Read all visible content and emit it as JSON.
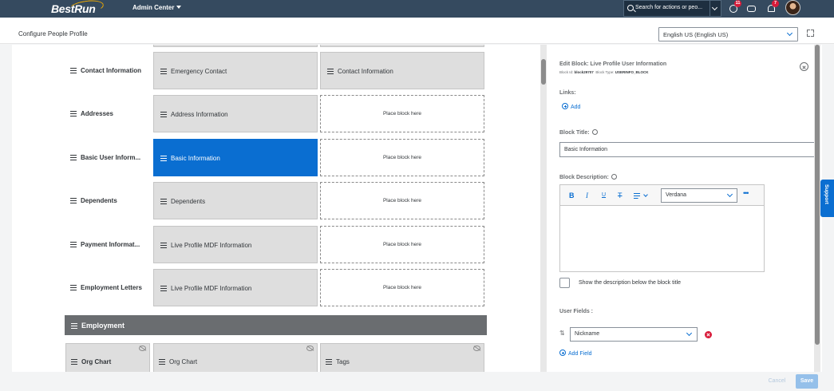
{
  "shell": {
    "logo": "BestRun",
    "menu_label": "Admin Center",
    "search_placeholder": "Search for actions or peo...",
    "notification_count": "11",
    "alert_count": "7"
  },
  "header": {
    "page_title": "Configure People Profile",
    "language": "English US (English US)"
  },
  "sections": [
    {
      "label": "Contact Information",
      "block1": "Emergency Contact",
      "block2": "Contact Information"
    },
    {
      "label": "Addresses",
      "block1": "Address Information",
      "block2": "Place block here"
    },
    {
      "label": "Basic User Inform...",
      "block1": "Basic Information",
      "block2": "Place block here"
    },
    {
      "label": "Dependents",
      "block1": "Dependents",
      "block2": "Place block here"
    },
    {
      "label": "Payment Informat...",
      "block1": "Live Profile MDF Information",
      "block2": "Place block here"
    },
    {
      "label": "Employment Letters",
      "block1": "Live Profile MDF Information",
      "block2": "Place block here"
    }
  ],
  "employment": {
    "title": "Employment",
    "blocks": [
      "Org Chart",
      "Org Chart",
      "Tags"
    ]
  },
  "panel": {
    "title": "Edit Block: Live Profile User Information",
    "block_id_label": "Block Id:",
    "block_id": "block29707",
    "block_type_label": "Block Type:",
    "block_type": "USERINFO_BLOCK",
    "links_label": "Links:",
    "add_label": "Add",
    "block_title_label": "Block Title:",
    "block_title_value": "Basic Information",
    "block_desc_label": "Block Description:",
    "font": "Verdana",
    "show_desc_label": "Show the description below the block title",
    "user_fields_label": "User Fields :",
    "user_field_value": "Nickname",
    "add_field_label": "Add Field"
  },
  "footer": {
    "cancel": "Cancel",
    "save": "Save"
  },
  "support": "Support",
  "colors": {
    "shell": "#354a5f",
    "accent": "#0a6ed1",
    "selected_block": "#0a6ed1",
    "employment_bar": "#6a6d70",
    "delete": "#d81b3a"
  }
}
